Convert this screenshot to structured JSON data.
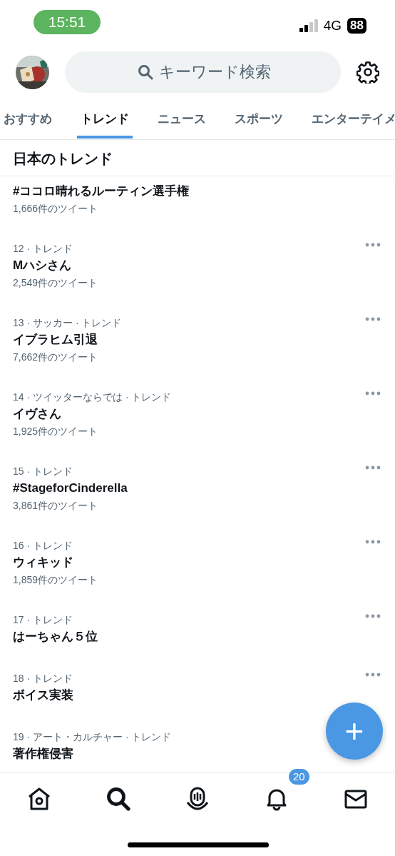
{
  "status_bar": {
    "time": "15:51",
    "network": "4G",
    "battery": "88"
  },
  "search": {
    "placeholder": "キーワード検索"
  },
  "tabs": [
    {
      "label": "おすすめ",
      "selected": false
    },
    {
      "label": "トレンド",
      "selected": true
    },
    {
      "label": "ニュース",
      "selected": false
    },
    {
      "label": "スポーツ",
      "selected": false
    },
    {
      "label": "エンターテイメ",
      "selected": false
    }
  ],
  "section_title": "日本のトレンド",
  "trends": [
    {
      "name": "#ココロ晴れるルーティン選手権",
      "count": "1,666件のツイート",
      "more": false
    },
    {
      "meta": "12 · トレンド",
      "name": "Mハシさん",
      "count": "2,549件のツイート",
      "more": true
    },
    {
      "meta": "13 · サッカー · トレンド",
      "name": "イブラヒム引退",
      "count": "7,662件のツイート",
      "more": true
    },
    {
      "meta": "14 · ツイッターならでは · トレンド",
      "name": "イヴさん",
      "count": "1,925件のツイート",
      "more": true
    },
    {
      "meta": "15 · トレンド",
      "name": "#StageforCinderella",
      "count": "3,861件のツイート",
      "more": true
    },
    {
      "meta": "16 · トレンド",
      "name": "ウィキッド",
      "count": "1,859件のツイート",
      "more": true
    },
    {
      "meta": "17 · トレンド",
      "name": "はーちゃん５位",
      "more": true
    },
    {
      "meta": "18 · トレンド",
      "name": "ボイス実装",
      "more": true
    },
    {
      "meta": "19 · アート・カルチャー · トレンド",
      "name": "著作権侵害",
      "more": false
    }
  ],
  "compose_button": "+",
  "bottom_nav": [
    {
      "kind": "home",
      "selected": false
    },
    {
      "kind": "search",
      "selected": true
    },
    {
      "kind": "spaces",
      "selected": false
    },
    {
      "kind": "notifications",
      "selected": false,
      "badge": "20"
    },
    {
      "kind": "messages",
      "selected": false
    }
  ]
}
